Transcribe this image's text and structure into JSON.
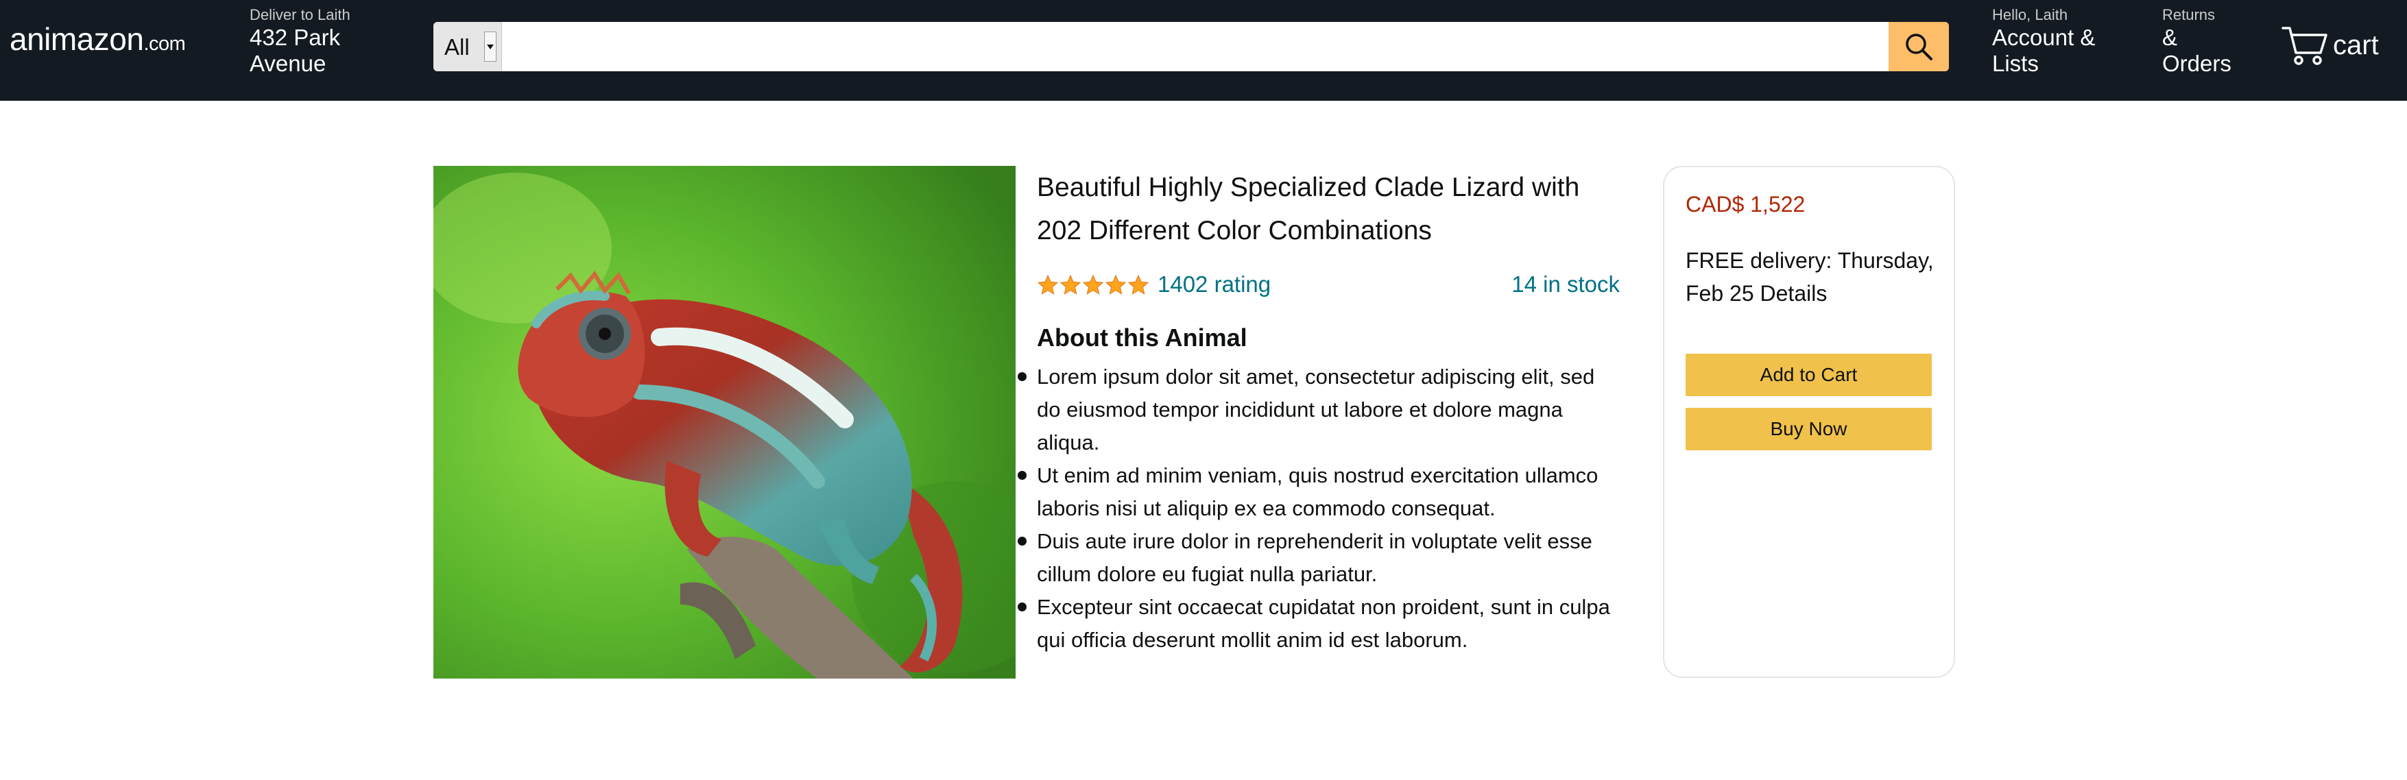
{
  "header": {
    "logo_main": "animazon",
    "logo_suffix": ".com",
    "deliver_label": "Deliver to Laith",
    "deliver_address": "432 Park Avenue",
    "search_category": "All",
    "search_placeholder": "",
    "account_greeting": "Hello, Laith",
    "account_label": "Account & Lists",
    "returns_label": "Returns",
    "orders_label": "& Orders",
    "cart_label": "cart"
  },
  "product": {
    "title": "Beautiful Highly Specialized Clade Lizard with 202 Different Color Combinations",
    "rating_stars": 5,
    "rating_text": "1402 rating",
    "stock_text": "14 in stock",
    "about_heading": "About this Animal",
    "bullets": [
      "Lorem ipsum dolor sit amet, consectetur adipiscing elit, sed do eiusmod tempor incididunt ut labore et dolore magna aliqua.",
      "Ut enim ad minim veniam, quis nostrud exercitation ullamco laboris nisi ut aliquip ex ea commodo consequat.",
      "Duis aute irure dolor in reprehenderit in voluptate velit esse cillum dolore eu fugiat nulla pariatur.",
      "Excepteur sint occaecat cupidatat non proident, sunt in culpa qui officia deserunt mollit anim id est laborum."
    ],
    "image_subject": "chameleon-on-branch"
  },
  "buybox": {
    "price": "CAD$ 1,522",
    "delivery": "FREE delivery: Thursday, Feb 25 Details",
    "add_to_cart": "Add to Cart",
    "buy_now": "Buy Now"
  },
  "colors": {
    "header_bg": "#131a22",
    "search_button": "#febd69",
    "button_bg": "#f0c14b",
    "link": "#007185",
    "price": "#b12704",
    "star": "#ffa41c"
  }
}
